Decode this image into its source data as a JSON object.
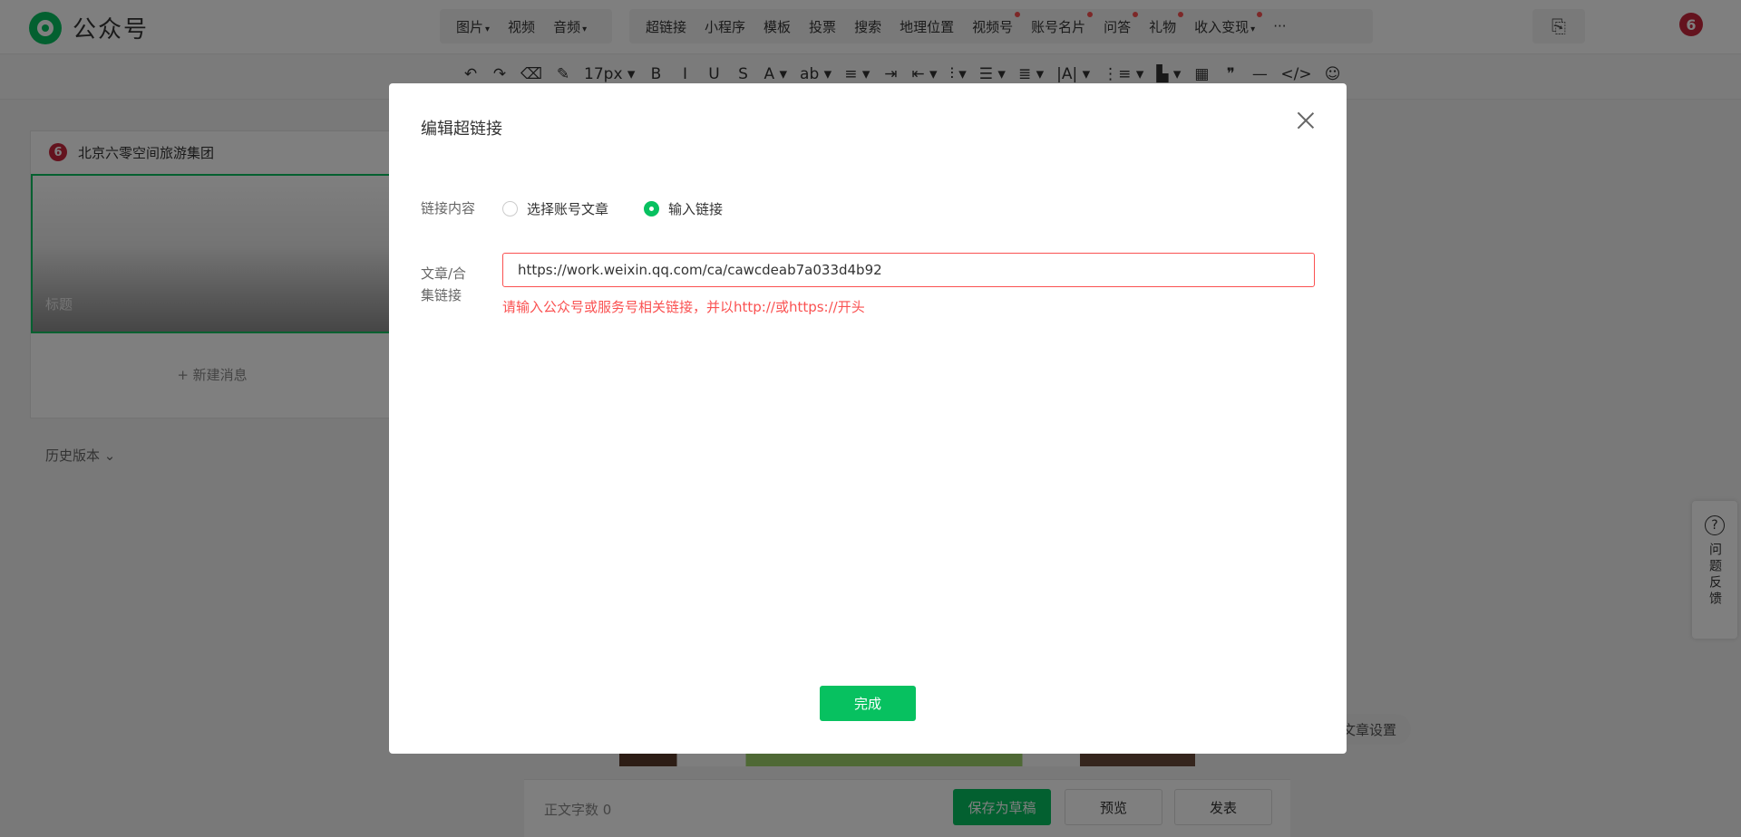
{
  "brand": {
    "name": "公众号"
  },
  "top_menu": {
    "group1": [
      {
        "label": "图片",
        "caret": "▾"
      },
      {
        "label": "视频"
      },
      {
        "label": "音频",
        "caret": "▾"
      }
    ],
    "group2": [
      {
        "label": "超链接"
      },
      {
        "label": "小程序"
      },
      {
        "label": "模板"
      },
      {
        "label": "投票"
      },
      {
        "label": "搜索"
      },
      {
        "label": "地理位置"
      },
      {
        "label": "视频号",
        "dot": true
      },
      {
        "label": "账号名片",
        "dot": true
      },
      {
        "label": "问答",
        "dot": true
      },
      {
        "label": "礼物",
        "dot": true
      },
      {
        "label": "收入变现",
        "caret": "▾",
        "dot": true
      },
      {
        "label": "···"
      }
    ],
    "right_icon": "exit-icon",
    "avatar_text": "6"
  },
  "format_toolbar": {
    "items": [
      "↶",
      "↷",
      "⌫",
      "✎",
      "17px ▾",
      "B",
      "I",
      "U",
      "S",
      "A ▾",
      "ab ▾",
      "≡ ▾",
      "⇥",
      "⇤ ▾",
      "⫶ ▾",
      "☰ ▾",
      "≣ ▾",
      "|A| ▾",
      "⋮≡ ▾",
      "▙ ▾",
      "▦",
      "❞",
      "—",
      "</>",
      "☺"
    ]
  },
  "left_panel": {
    "account_name": "北京六零空间旅游集团",
    "account_avatar": "6",
    "cover_title_placeholder": "标题",
    "new_message": "+  新建消息",
    "history_version": "历史版本 ⌄"
  },
  "editor_footer": {
    "word_count_label": "正文字数  0",
    "save_draft": "保存为草稿",
    "preview": "预览",
    "publish": "发表",
    "article_settings": "文章设置"
  },
  "feedback": {
    "icon": "?",
    "label": "问题反馈"
  },
  "dialog": {
    "title": "编辑超链接",
    "content_label": "链接内容",
    "options": [
      {
        "label": "选择账号文章",
        "selected": false
      },
      {
        "label": "输入链接",
        "selected": true
      }
    ],
    "link_label": "文章/合集链接",
    "url_value": "https://work.weixin.qq.com/ca/cawcdeab7a033d4b92",
    "error_text": "请输入公众号或服务号相关链接，并以http://或https://开头",
    "done_button": "完成"
  },
  "colors": {
    "accent": "#07c160",
    "error": "#fa5151",
    "overlay": "rgba(0,0,0,0.5)"
  }
}
